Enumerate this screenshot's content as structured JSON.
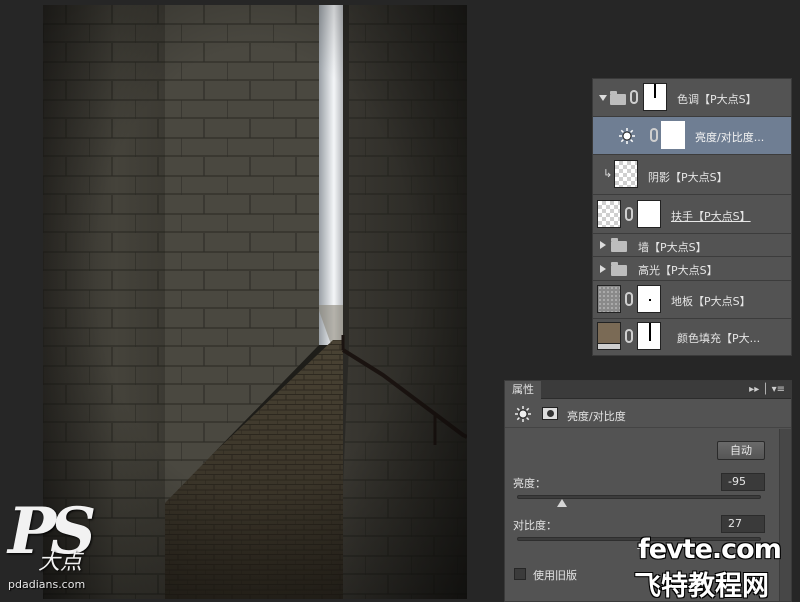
{
  "layers": [
    {
      "name": "色调【P大点S】",
      "type": "group",
      "expanded": true
    },
    {
      "name": "亮度/对比度...",
      "type": "adjustment",
      "selected": true
    },
    {
      "name": "阴影【P大点S】",
      "type": "layer",
      "clipped": true
    },
    {
      "name": "扶手【P大点S】",
      "type": "layer"
    },
    {
      "name": "墙【P大点S】",
      "type": "group",
      "expanded": false
    },
    {
      "name": "高光【P大点S】",
      "type": "group",
      "expanded": false
    },
    {
      "name": "地板【P大点S】",
      "type": "layer"
    },
    {
      "name": "颜色填充【P大...",
      "type": "fill"
    }
  ],
  "properties": {
    "tab": "属性",
    "title": "亮度/对比度",
    "auto_button": "自动",
    "brightness_label": "亮度：",
    "brightness_value": "-95",
    "brightness_level": -95,
    "contrast_label": "对比度：",
    "contrast_value": "27",
    "contrast_level": 27,
    "legacy_label": "使用旧版",
    "legacy_checked": false
  },
  "watermark": {
    "logo": "PS",
    "logo_cn": "大点",
    "url": "pdadians.com"
  },
  "site": {
    "line1": "fevte.com",
    "line2": "飞特教程网"
  },
  "colors": {
    "panel": "#535353",
    "selected_row": "#6f7e93",
    "canvas_bg": "#262626",
    "fill_swatch": "#7a6a55"
  }
}
